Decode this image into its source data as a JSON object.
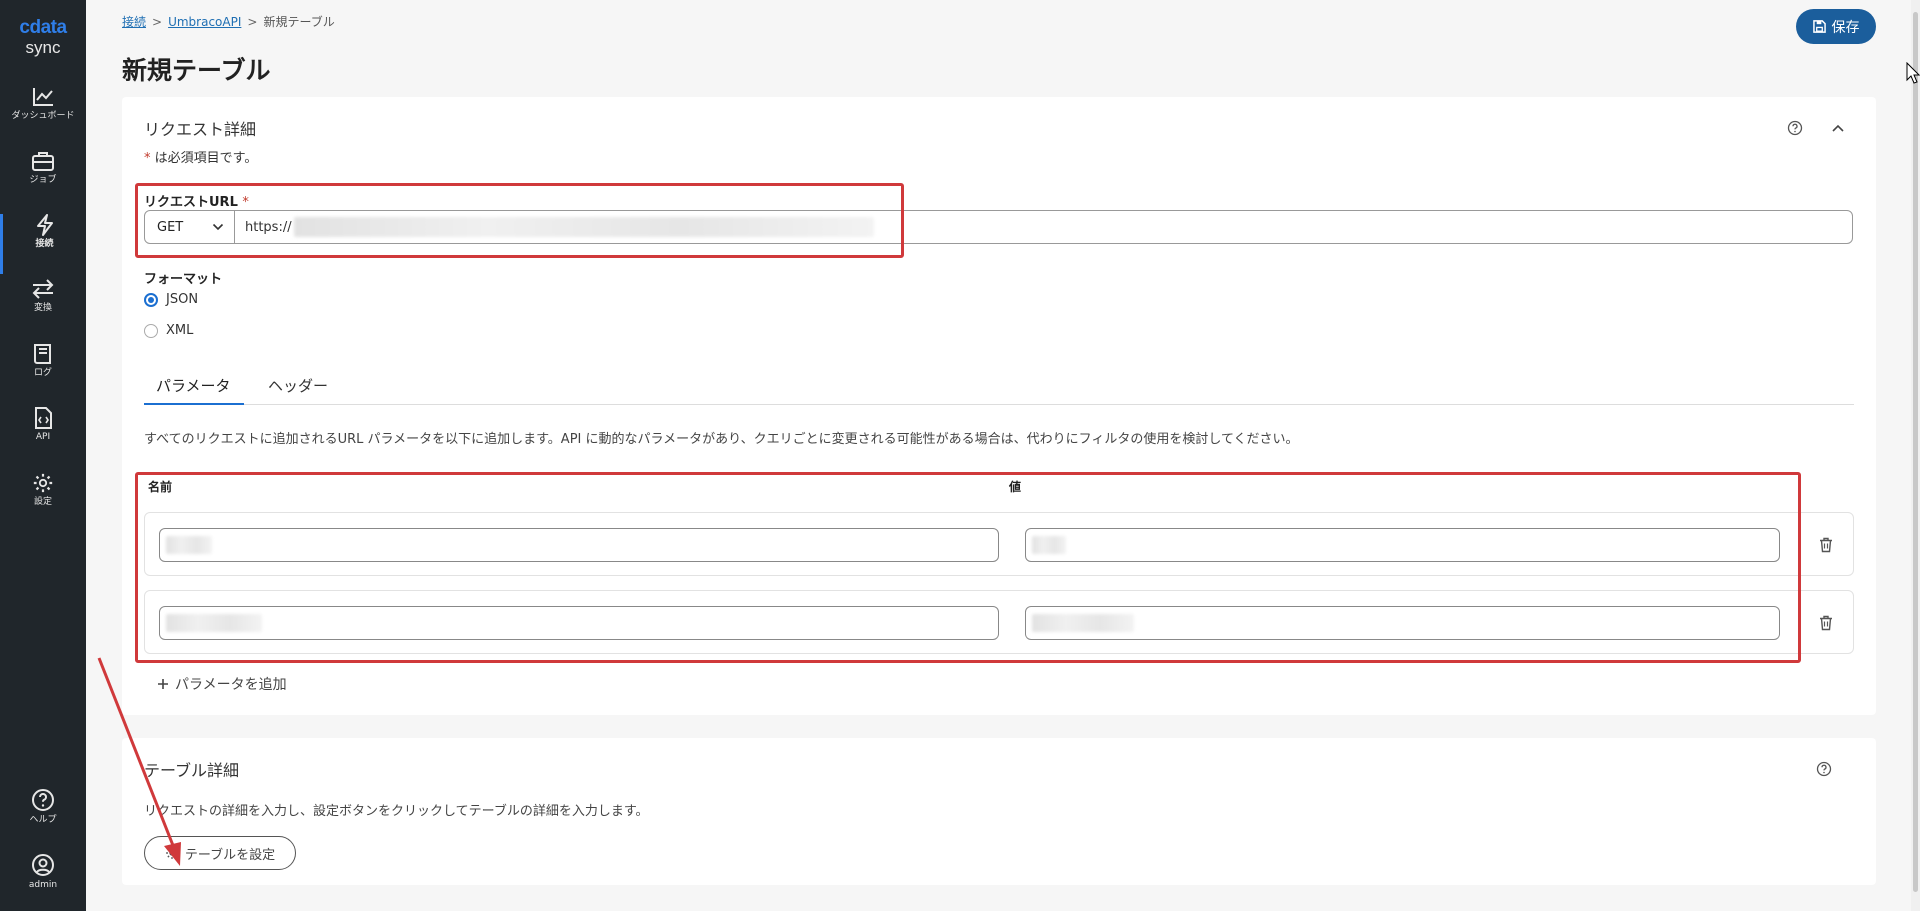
{
  "sidebar": {
    "logo_top": "cdata",
    "logo_bottom": "sync",
    "items": [
      {
        "label": "ダッシュボード",
        "icon": "chart-line-icon"
      },
      {
        "label": "ジョブ",
        "icon": "briefcase-icon"
      },
      {
        "label": "接続",
        "icon": "lightning-icon",
        "active": true
      },
      {
        "label": "変換",
        "icon": "arrows-exchange-icon"
      },
      {
        "label": "ログ",
        "icon": "book-icon"
      },
      {
        "label": "API",
        "icon": "code-file-icon"
      },
      {
        "label": "設定",
        "icon": "gear-icon"
      }
    ],
    "bottom_items": [
      {
        "label": "ヘルプ",
        "icon": "help-circle-icon"
      },
      {
        "label": "admin",
        "icon": "user-icon"
      }
    ]
  },
  "breadcrumb": {
    "items": [
      "接続",
      "UmbracoAPI",
      "新規テーブル"
    ],
    "separator": ">"
  },
  "page_title": "新規テーブル",
  "save_button": "保存",
  "request": {
    "section_title": "リクエスト詳細",
    "required_star": "*",
    "required_note": " は必須項目です。",
    "url_label": "リクエストURL",
    "method": "GET",
    "url_prefix": "https://",
    "format_label": "フォーマット",
    "formats": [
      {
        "label": "JSON",
        "selected": true
      },
      {
        "label": "XML",
        "selected": false
      }
    ],
    "tabs": [
      "パラメータ",
      "ヘッダー"
    ],
    "active_tab": 0,
    "description": "すべてのリクエストに追加されるURL パラメータを以下に追加します。API に動的なパラメータがあり、クエリごとに変更される可能性がある場合は、代わりにフィルタの使用を検討してください。",
    "col_name": "名前",
    "col_value": "値",
    "add_param": "パラメータを追加"
  },
  "table": {
    "section_title": "テーブル詳細",
    "description": "リクエストの詳細を入力し、設定ボタンをクリックしてテーブルの詳細を入力します。",
    "config_button": "テーブルを設定"
  },
  "colors": {
    "sidebar_bg": "#20262b",
    "accent": "#1b5e9c",
    "link": "#1f6fb3",
    "annotation": "#d0393b"
  }
}
